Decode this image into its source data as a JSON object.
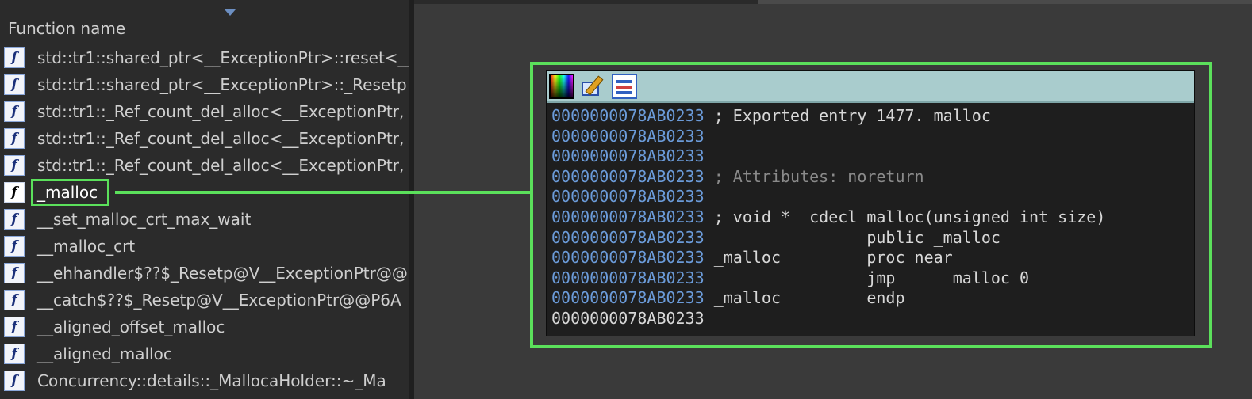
{
  "function_panel": {
    "header": "Function name",
    "items": [
      {
        "name": "std::tr1::shared_ptr<__ExceptionPtr>::reset<__",
        "selected": false
      },
      {
        "name": "std::tr1::shared_ptr<__ExceptionPtr>::_Resetp",
        "selected": false
      },
      {
        "name": "std::tr1::_Ref_count_del_alloc<__ExceptionPtr,",
        "selected": false
      },
      {
        "name": "std::tr1::_Ref_count_del_alloc<__ExceptionPtr,",
        "selected": false
      },
      {
        "name": "std::tr1::_Ref_count_del_alloc<__ExceptionPtr,",
        "selected": false
      },
      {
        "name": "_malloc",
        "selected": true
      },
      {
        "name": "__set_malloc_crt_max_wait",
        "selected": false
      },
      {
        "name": "__malloc_crt",
        "selected": false
      },
      {
        "name": "__ehhandler$??$_Resetp@V__ExceptionPtr@@",
        "selected": false
      },
      {
        "name": "__catch$??$_Resetp@V__ExceptionPtr@@P6A",
        "selected": false
      },
      {
        "name": "__aligned_offset_malloc",
        "selected": false
      },
      {
        "name": "__aligned_malloc",
        "selected": false
      },
      {
        "name": "Concurrency::details::_MallocaHolder::~_Ma",
        "selected": false
      }
    ],
    "icon": "function-icon",
    "icon_glyph": "f"
  },
  "popup": {
    "toolbar": [
      {
        "name": "color-palette-icon"
      },
      {
        "name": "edit-icon"
      },
      {
        "name": "sync-icon"
      }
    ],
    "lines": [
      {
        "addr": "0000000078AB0233",
        "text": " ; Exported entry 1477. malloc",
        "kind": "code"
      },
      {
        "addr": "0000000078AB0233",
        "text": "",
        "kind": "code"
      },
      {
        "addr": "0000000078AB0233",
        "text": "",
        "kind": "code"
      },
      {
        "addr": "0000000078AB0233",
        "text": " ; Attributes: noreturn",
        "kind": "comment"
      },
      {
        "addr": "0000000078AB0233",
        "text": "",
        "kind": "code"
      },
      {
        "addr": "0000000078AB0233",
        "text": " ; void *__cdecl malloc(unsigned int size)",
        "kind": "code"
      },
      {
        "addr": "0000000078AB0233",
        "text": "                 public _malloc",
        "kind": "code"
      },
      {
        "addr": "0000000078AB0233",
        "text": " _malloc         proc near",
        "kind": "code"
      },
      {
        "addr": "0000000078AB0233",
        "text": "                 jmp     _malloc_0",
        "kind": "code"
      },
      {
        "addr": "0000000078AB0233",
        "text": " _malloc         endp",
        "kind": "code"
      },
      {
        "addr": "0000000078AB0233",
        "text": "",
        "kind": "last"
      }
    ]
  },
  "colors": {
    "highlight": "#5be05b",
    "address": "#6b9bd9",
    "toolbar_bg": "#a9cccd"
  }
}
